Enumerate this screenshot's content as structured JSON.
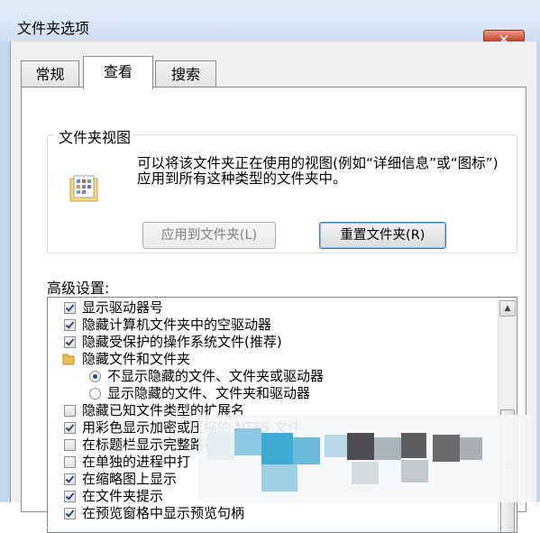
{
  "window": {
    "title": "文件夹选项",
    "close_label": "✕"
  },
  "tabs": [
    {
      "label": "常规",
      "active": false
    },
    {
      "label": "查看",
      "active": true
    },
    {
      "label": "搜索",
      "active": false
    }
  ],
  "folder_views": {
    "title": "文件夹视图",
    "description": "可以将该文件夹正在使用的视图(例如“详细信息”或“图标”)应用到所有这种类型的文件夹中。",
    "apply_button": "应用到文件夹(L)",
    "reset_button": "重置文件夹(R)"
  },
  "advanced": {
    "label": "高级设置:",
    "items": [
      {
        "type": "checkbox",
        "checked": true,
        "label": "显示驱动器号"
      },
      {
        "type": "checkbox",
        "checked": true,
        "label": "隐藏计算机文件夹中的空驱动器"
      },
      {
        "type": "checkbox",
        "checked": true,
        "label": "隐藏受保护的操作系统文件(推荐)"
      },
      {
        "type": "folder",
        "label": "隐藏文件和文件夹"
      },
      {
        "type": "radio",
        "selected": true,
        "label": "不显示隐藏的文件、文件夹或驱动器"
      },
      {
        "type": "radio",
        "selected": false,
        "label": "显示隐藏的文件、文件夹和驱动器"
      },
      {
        "type": "checkbox",
        "checked": false,
        "label": "隐藏已知文件类型的扩展名"
      },
      {
        "type": "checkbox",
        "checked": true,
        "label": "用彩色显示加密或压缩的 NTFS 文件"
      },
      {
        "type": "checkbox",
        "checked": false,
        "label": "在标题栏显示完整路径(仅限经典主题)"
      },
      {
        "type": "checkbox",
        "checked": false,
        "label": "在单独的进程中打"
      },
      {
        "type": "checkbox",
        "checked": true,
        "label": "在缩略图上显示"
      },
      {
        "type": "checkbox",
        "checked": true,
        "label": "在文件夹提示"
      },
      {
        "type": "checkbox",
        "checked": true,
        "label": "在预览窗格中显示预览句柄"
      }
    ]
  },
  "colors": {
    "accent": "#3c7fb1",
    "close": "#c7432b"
  }
}
